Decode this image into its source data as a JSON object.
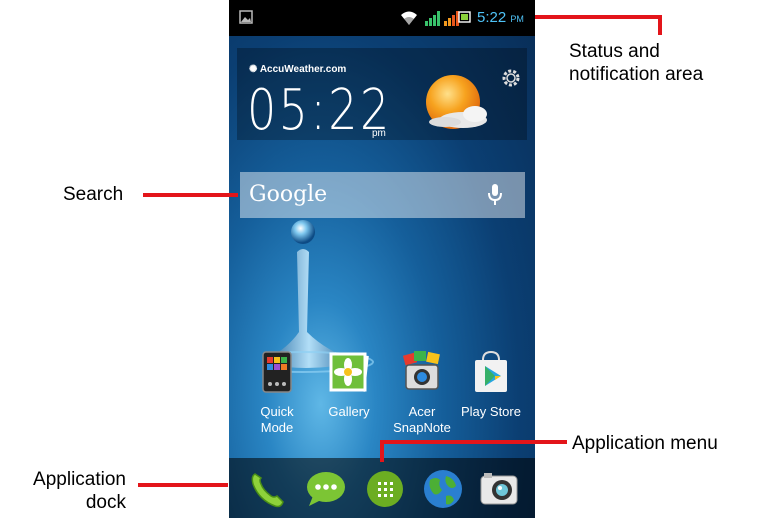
{
  "status_bar": {
    "time": "5:22",
    "ampm": "PM",
    "icons": [
      "image-icon",
      "wifi-icon",
      "signal-icon",
      "signal-icon",
      "battery-icon"
    ]
  },
  "weather_widget": {
    "provider": "AccuWeather.com",
    "time": "05:22",
    "ampm": "pm",
    "icons": [
      "sun-cloud-icon",
      "gear-icon"
    ]
  },
  "search": {
    "brand": "Google",
    "icon": "microphone-icon"
  },
  "apps": [
    {
      "label": "Quick Mode",
      "icon": "quick-mode-icon"
    },
    {
      "label": "Gallery",
      "icon": "gallery-icon"
    },
    {
      "label": "Acer SnapNote",
      "icon": "snapnote-icon"
    },
    {
      "label": "Play Store",
      "icon": "play-store-icon"
    }
  ],
  "dock": {
    "icons": [
      "phone-icon",
      "messaging-icon",
      "app-menu-icon",
      "browser-globe-icon",
      "camera-icon"
    ]
  },
  "callouts": {
    "status": "Status and notification area",
    "search": "Search",
    "app_menu": "Application menu",
    "dock": "Application dock"
  },
  "colors": {
    "callout_line": "#e3151a",
    "status_clock": "#4fc3f7"
  }
}
